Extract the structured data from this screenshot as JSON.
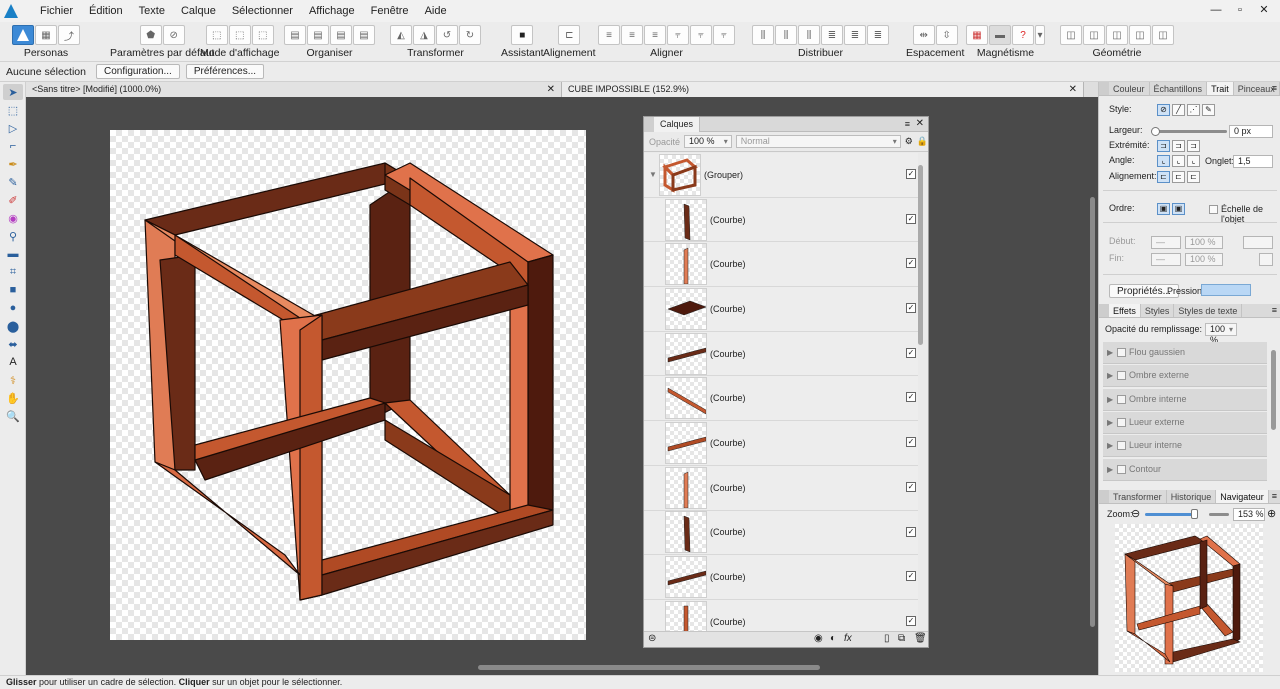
{
  "menubar": {
    "items": [
      "Fichier",
      "Édition",
      "Texte",
      "Calque",
      "Sélectionner",
      "Affichage",
      "Fenêtre",
      "Aide"
    ],
    "controls": {
      "minimize": "—",
      "restore": "▫",
      "close": "✕"
    }
  },
  "toolbar": {
    "personas": "Personas",
    "defaults": "Paramètres par défaut",
    "view_mode": "Mode d'affichage",
    "arrange": "Organiser",
    "transform": "Transformer",
    "assistant": "Assistant",
    "alignment": "Alignement",
    "align": "Aligner",
    "distribute": "Distribuer",
    "spacing": "Espacement",
    "snapping": "Magnétisme",
    "geometry": "Géométrie"
  },
  "contextbar": {
    "no_selection": "Aucune sélection",
    "config_button": "Configuration...",
    "prefs_button": "Préférences..."
  },
  "doc_tabs": [
    {
      "label": "<Sans titre> [Modifié] (1000.0%)",
      "close": "✕"
    },
    {
      "label": "CUBE IMPOSSIBLE (152.9%)",
      "close": "✕"
    }
  ],
  "layers_panel": {
    "tab": "Calques",
    "opacity_label": "Opacité",
    "opacity_value": "100 %",
    "blend_mode": "Normal",
    "group_name": "(Grouper)",
    "layers": [
      {
        "name": "(Courbe)",
        "visible": true,
        "thumb": "vertical-dark"
      },
      {
        "name": "(Courbe)",
        "visible": true,
        "thumb": "vertical-light"
      },
      {
        "name": "(Courbe)",
        "visible": true,
        "thumb": "plane"
      },
      {
        "name": "(Courbe)",
        "visible": true,
        "thumb": "diag-up"
      },
      {
        "name": "(Courbe)",
        "visible": true,
        "thumb": "diag-down"
      },
      {
        "name": "(Courbe)",
        "visible": true,
        "thumb": "diag-up-light"
      },
      {
        "name": "(Courbe)",
        "visible": true,
        "thumb": "vertical-light"
      },
      {
        "name": "(Courbe)",
        "visible": true,
        "thumb": "vertical-dark"
      },
      {
        "name": "(Courbe)",
        "visible": true,
        "thumb": "diag-up"
      },
      {
        "name": "(Courbe)",
        "visible": true,
        "thumb": "vertical-mid"
      }
    ],
    "check_glyph": "✓",
    "footer": {
      "fx": "fx"
    }
  },
  "right_panel": {
    "stroke_tabs": [
      "Couleur",
      "Échantillons",
      "Trait",
      "Pinceaux"
    ],
    "stroke_active": "Trait",
    "style_label": "Style:",
    "width_label": "Largeur:",
    "width_value": "0 px",
    "caps_label": "Extrémité:",
    "join_label": "Angle:",
    "miter_label": "Onglet:",
    "miter_value": "1,5",
    "align_label": "Alignement:",
    "order_label": "Ordre:",
    "scale_label": "Échelle de l'objet",
    "start_label": "Début:",
    "start_value": "100 %",
    "end_label": "Fin:",
    "end_value": "100 %",
    "properties_button": "Propriétés...",
    "pressure_label": "Pression:",
    "effects_tabs": [
      "Effets",
      "Styles",
      "Styles de texte"
    ],
    "effects_active": "Effets",
    "fill_opacity_label": "Opacité du remplissage:",
    "fill_opacity_value": "100 %",
    "effects": [
      "Flou gaussien",
      "Ombre externe",
      "Ombre interne",
      "Lueur externe",
      "Lueur interne",
      "Contour"
    ],
    "nav_tabs": [
      "Transformer",
      "Historique",
      "Navigateur"
    ],
    "nav_active": "Navigateur",
    "zoom_label": "Zoom:",
    "zoom_value": "153 %",
    "zoom_level": 0.58
  },
  "statusbar": {
    "b1": "Glisser",
    "t1": " pour utiliser un cadre de sélection. ",
    "b2": "Cliquer",
    "t2": " sur un objet pour le sélectionner."
  },
  "colors": {
    "accent": "#3d8ad6",
    "cube_light": "#e0724b",
    "cube_mid": "#c4582f",
    "cube_dark": "#6a2b17",
    "cube_darker": "#4e1a0d"
  }
}
